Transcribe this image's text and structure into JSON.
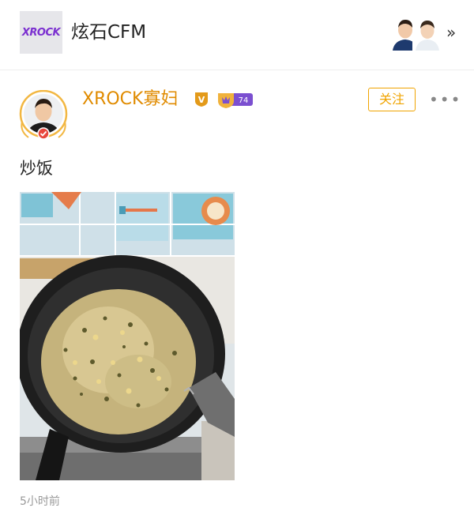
{
  "group": {
    "logo_text": "XROCK",
    "title": "炫石CFM",
    "more_icon": "double-chevron-right-icon"
  },
  "post": {
    "author_name": "XROCK寡妇",
    "vip_badge": "V",
    "level": "74",
    "follow_label": "关注",
    "more_icon": "ellipsis-icon",
    "text": "炒饭",
    "photo_desc": "pan-of-fried-rice-photo",
    "timestamp": "5小时前"
  },
  "colors": {
    "accent": "#f0a400",
    "author": "#e08b00",
    "level_badge": "#7b4fd0",
    "muted": "#999999"
  }
}
